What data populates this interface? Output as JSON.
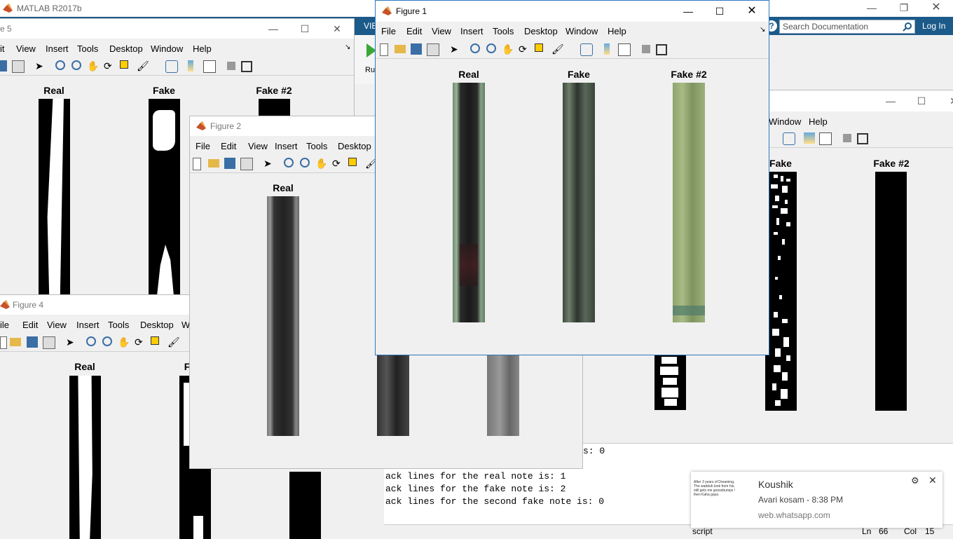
{
  "matlab": {
    "title": "MATLAB R2017b",
    "search_placeholder": "Search Documentation",
    "login_label": "Log In",
    "tab_fragment": "VIE",
    "run_fragment": "Ru"
  },
  "figure5": {
    "title_fragment": "e 5",
    "menu": [
      "it",
      "View",
      "Insert",
      "Tools",
      "Desktop",
      "Window",
      "Help"
    ],
    "axes": [
      "Real",
      "Fake",
      "Fake #2"
    ]
  },
  "figure2": {
    "title": "Figure 2",
    "menu": [
      "File",
      "Edit",
      "View",
      "Insert",
      "Tools",
      "Desktop"
    ],
    "axes": [
      "Real"
    ]
  },
  "figure4": {
    "title": "Figure 4",
    "menu": [
      "ile",
      "Edit",
      "View",
      "Insert",
      "Tools",
      "Desktop",
      "W"
    ],
    "axes": [
      "Real",
      "F"
    ]
  },
  "figure1": {
    "title": "Figure 1",
    "menu": [
      "File",
      "Edit",
      "View",
      "Insert",
      "Tools",
      "Desktop",
      "Window",
      "Help"
    ],
    "axes": [
      "Real",
      "Fake",
      "Fake #2"
    ]
  },
  "figure3": {
    "menu": [
      "Window",
      "Help"
    ],
    "axes": [
      "Fake",
      "Fake #2"
    ]
  },
  "console": {
    "lines": [
      "s: 0",
      "ack lines for the real note is: 1",
      "ack lines for the fake note is: 2",
      "ack lines for the second fake note is: 0"
    ]
  },
  "statusbar": {
    "mode": "script",
    "ln_label": "Ln",
    "ln_value": "66",
    "col_label": "Col",
    "col_value": "15"
  },
  "notification": {
    "sender": "Koushik",
    "message": "Avari kosam - 8:38 PM",
    "source": "web.whatsapp.com",
    "thumb_text": "After 3 years of Dreaming, The wadduh look from his, still gets me goosebumps ! then Kaha gaya"
  },
  "icons": {
    "close": "close-icon",
    "minimize": "minimize-icon",
    "maximize": "maximize-icon",
    "restore": "restore-icon",
    "search": "search-icon",
    "help": "help-icon",
    "gear": "gear-icon"
  }
}
